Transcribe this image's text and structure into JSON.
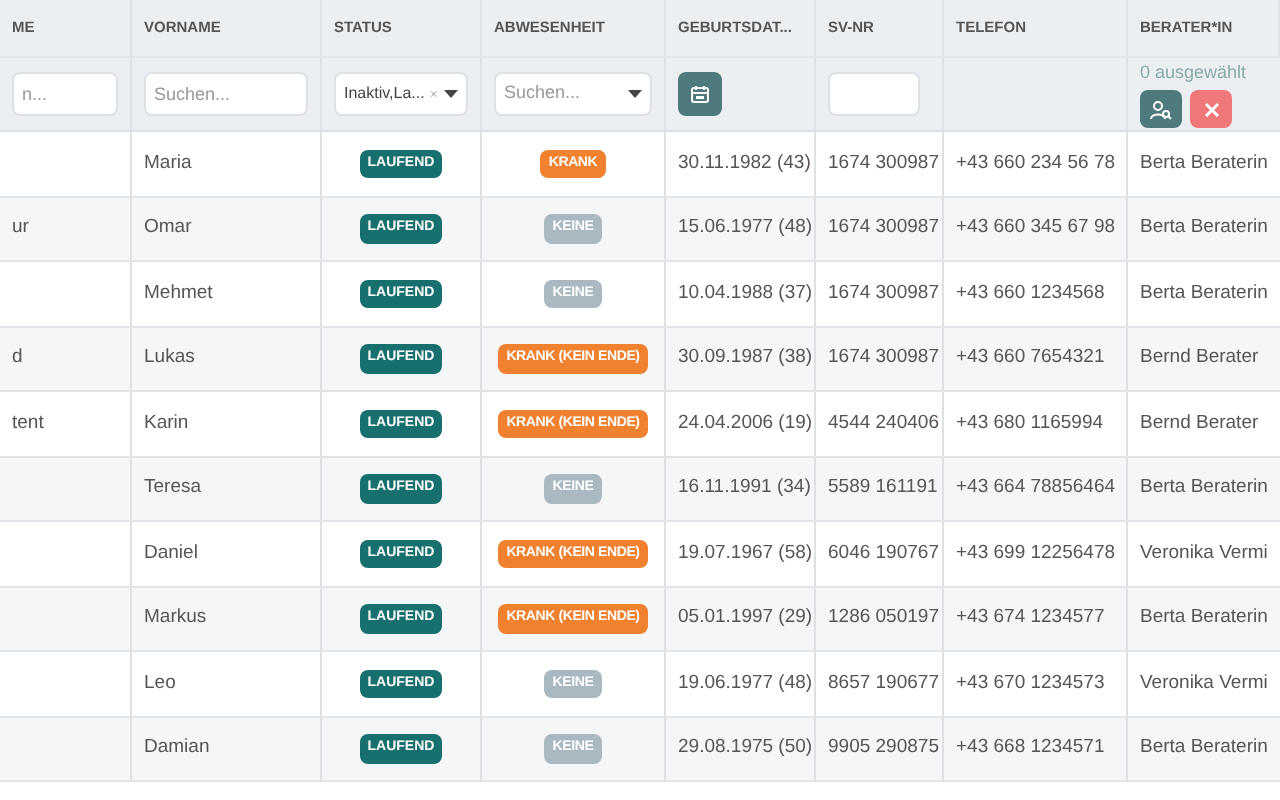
{
  "columns": [
    "ME",
    "VORNAME",
    "STATUS",
    "ABWESENHEIT",
    "GEBURTSDAT...",
    "SV-NR",
    "TELEFON",
    "BERATER*IN"
  ],
  "filters": {
    "name": {
      "placeholder": "n..."
    },
    "vorname": {
      "placeholder": "Suchen..."
    },
    "status": {
      "value": "Inaktiv,La..."
    },
    "abwesenheit": {
      "placeholder": "Suchen..."
    },
    "berater": {
      "selected_count": "0 ausgewählt"
    }
  },
  "rows": [
    {
      "name": "",
      "vorname": "Maria",
      "status": "LAUFEND",
      "absence": {
        "kind": "krank",
        "label": "KRANK"
      },
      "geburtsdatum": "30.11.1982 (43)",
      "sv_nr": "1674 300987",
      "telefon": "+43 660 234 56 78",
      "berater": "Berta Beraterin"
    },
    {
      "name": "ur",
      "vorname": "Omar",
      "status": "LAUFEND",
      "absence": {
        "kind": "keine",
        "label": "KEINE"
      },
      "geburtsdatum": "15.06.1977 (48)",
      "sv_nr": "1674 300987",
      "telefon": "+43 660 345 67 98",
      "berater": "Berta Beraterin"
    },
    {
      "name": "",
      "vorname": "Mehmet",
      "status": "LAUFEND",
      "absence": {
        "kind": "keine",
        "label": "KEINE"
      },
      "geburtsdatum": "10.04.1988 (37)",
      "sv_nr": "1674 300987",
      "telefon": "+43 660 1234568",
      "berater": "Berta Beraterin"
    },
    {
      "name": "d",
      "vorname": "Lukas",
      "status": "LAUFEND",
      "absence": {
        "kind": "krank",
        "label": "KRANK (KEIN ENDE)"
      },
      "geburtsdatum": "30.09.1987 (38)",
      "sv_nr": "1674 300987",
      "telefon": "+43 660 7654321",
      "berater": "Bernd Berater"
    },
    {
      "name": "tent",
      "vorname": "Karin",
      "status": "LAUFEND",
      "absence": {
        "kind": "krank",
        "label": "KRANK (KEIN ENDE)"
      },
      "geburtsdatum": "24.04.2006 (19)",
      "sv_nr": "4544 240406",
      "telefon": "+43 680 1165994",
      "berater": "Bernd Berater"
    },
    {
      "name": "",
      "vorname": "Teresa",
      "status": "LAUFEND",
      "absence": {
        "kind": "keine",
        "label": "KEINE"
      },
      "geburtsdatum": "16.11.1991 (34)",
      "sv_nr": "5589 161191",
      "telefon": "+43 664 78856464",
      "berater": "Berta Beraterin"
    },
    {
      "name": "",
      "vorname": "Daniel",
      "status": "LAUFEND",
      "absence": {
        "kind": "krank",
        "label": "KRANK (KEIN ENDE)"
      },
      "geburtsdatum": "19.07.1967 (58)",
      "sv_nr": "6046 190767",
      "telefon": "+43 699 12256478",
      "berater": "Veronika Vermi"
    },
    {
      "name": "",
      "vorname": "Markus",
      "status": "LAUFEND",
      "absence": {
        "kind": "krank",
        "label": "KRANK (KEIN ENDE)"
      },
      "geburtsdatum": "05.01.1997 (29)",
      "sv_nr": "1286 050197",
      "telefon": "+43 674 1234577",
      "berater": "Berta Beraterin"
    },
    {
      "name": "",
      "vorname": "Leo",
      "status": "LAUFEND",
      "absence": {
        "kind": "keine",
        "label": "KEINE"
      },
      "geburtsdatum": "19.06.1977 (48)",
      "sv_nr": "8657 190677",
      "telefon": "+43 670 1234573",
      "berater": "Veronika Vermi"
    },
    {
      "name": "",
      "vorname": "Damian",
      "status": "LAUFEND",
      "absence": {
        "kind": "keine",
        "label": "KEINE"
      },
      "geburtsdatum": "29.08.1975 (50)",
      "sv_nr": "9905 290875",
      "telefon": "+43 668 1234571",
      "berater": "Berta Beraterin"
    }
  ]
}
